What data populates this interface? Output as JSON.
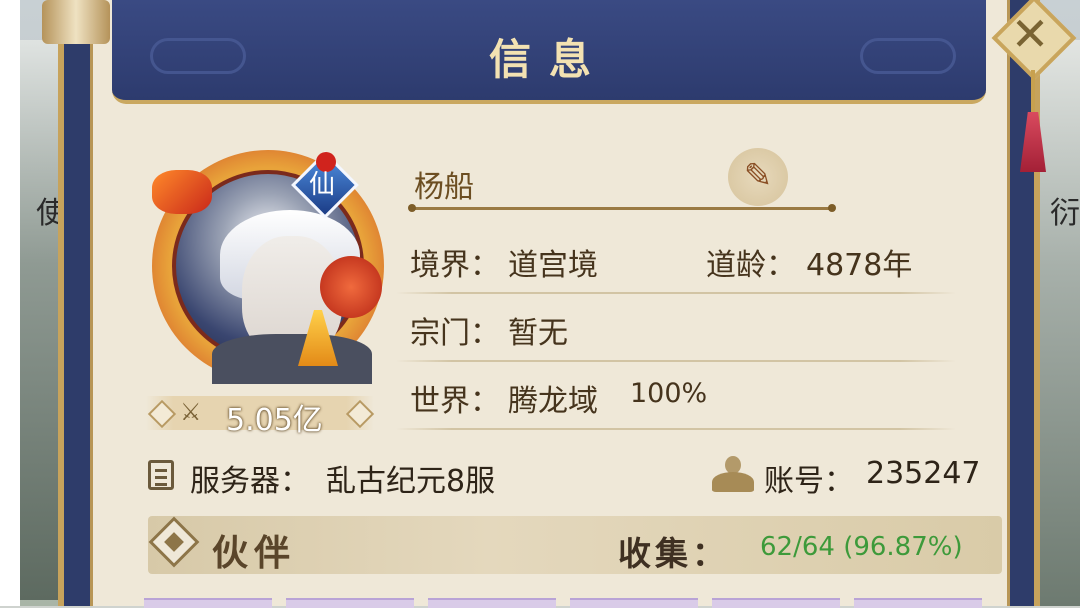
{
  "window": {
    "title": "信息"
  },
  "side_glyphs": {
    "left": "使",
    "right": "衍"
  },
  "player": {
    "name": "杨船",
    "power": "5.05亿",
    "avatar_badge": "仙"
  },
  "info": {
    "realm_label": "境界：",
    "realm_value": "道宫境",
    "age_label": "道龄：",
    "age_value": "4878年",
    "sect_label": "宗门：",
    "sect_value": "暂无",
    "world_label": "世界：",
    "world_value": "腾龙域",
    "world_percent": "100%"
  },
  "server": {
    "label": "服务器：",
    "value": "乱古纪元8服"
  },
  "account": {
    "label": "账号：",
    "value": "235247"
  },
  "partner": {
    "title": "伙伴",
    "collect_label": "收集：",
    "collect_value": "62/64 (96.87%)"
  },
  "icons": {
    "close": "close-icon",
    "brush": "brush-icon",
    "power": "power-icon",
    "server": "document-icon",
    "account": "account-icon"
  },
  "colors": {
    "banner": "#2d3b6e",
    "paper": "#efe8d8",
    "gold": "#caa860",
    "collect_green": "#3d9a3a"
  }
}
